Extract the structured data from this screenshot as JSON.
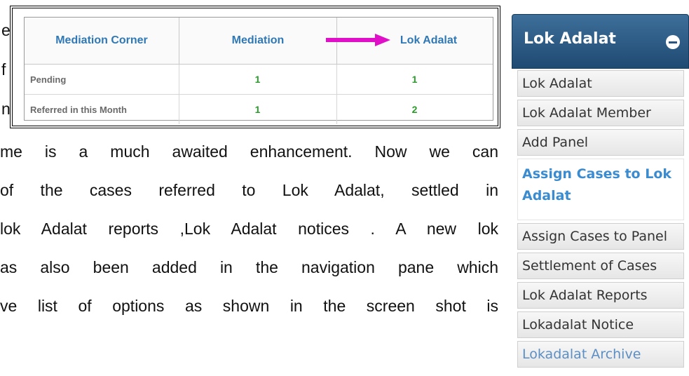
{
  "body_text": {
    "fragments": [
      "e",
      "f",
      "n"
    ],
    "lines": [
      "me is a much awaited enhancement. Now we can",
      " of the cases referred to Lok Adalat, settled in",
      "lok Adalat reports ,Lok Adalat notices . A new lok",
      "as also been added in the navigation pane which",
      "ve list of options  as shown in the screen shot is"
    ]
  },
  "mediation_table": {
    "headers": [
      "Mediation Corner",
      "Mediation",
      "Lok Adalat"
    ],
    "rows": [
      {
        "label": "Pending",
        "mediation": "1",
        "lok_adalat": "1"
      },
      {
        "label": "Referred in this Month",
        "mediation": "1",
        "lok_adalat": "2"
      }
    ],
    "arrow_color": "#e010c8",
    "header_color": "#2f78b5",
    "value_color": "#2a9a2a"
  },
  "nav": {
    "title": "Lok Adalat",
    "header_color": "#2a5680",
    "active_color": "#3a8bd0",
    "items": [
      "Lok Adalat",
      "Lok Adalat Member",
      "Add Panel",
      "Assign Cases to Lok Adalat",
      "Assign Cases to Panel",
      "Settlement of Cases",
      "Lok Adalat Reports",
      "Lokadalat Notice",
      "Lokadalat Archive"
    ]
  }
}
